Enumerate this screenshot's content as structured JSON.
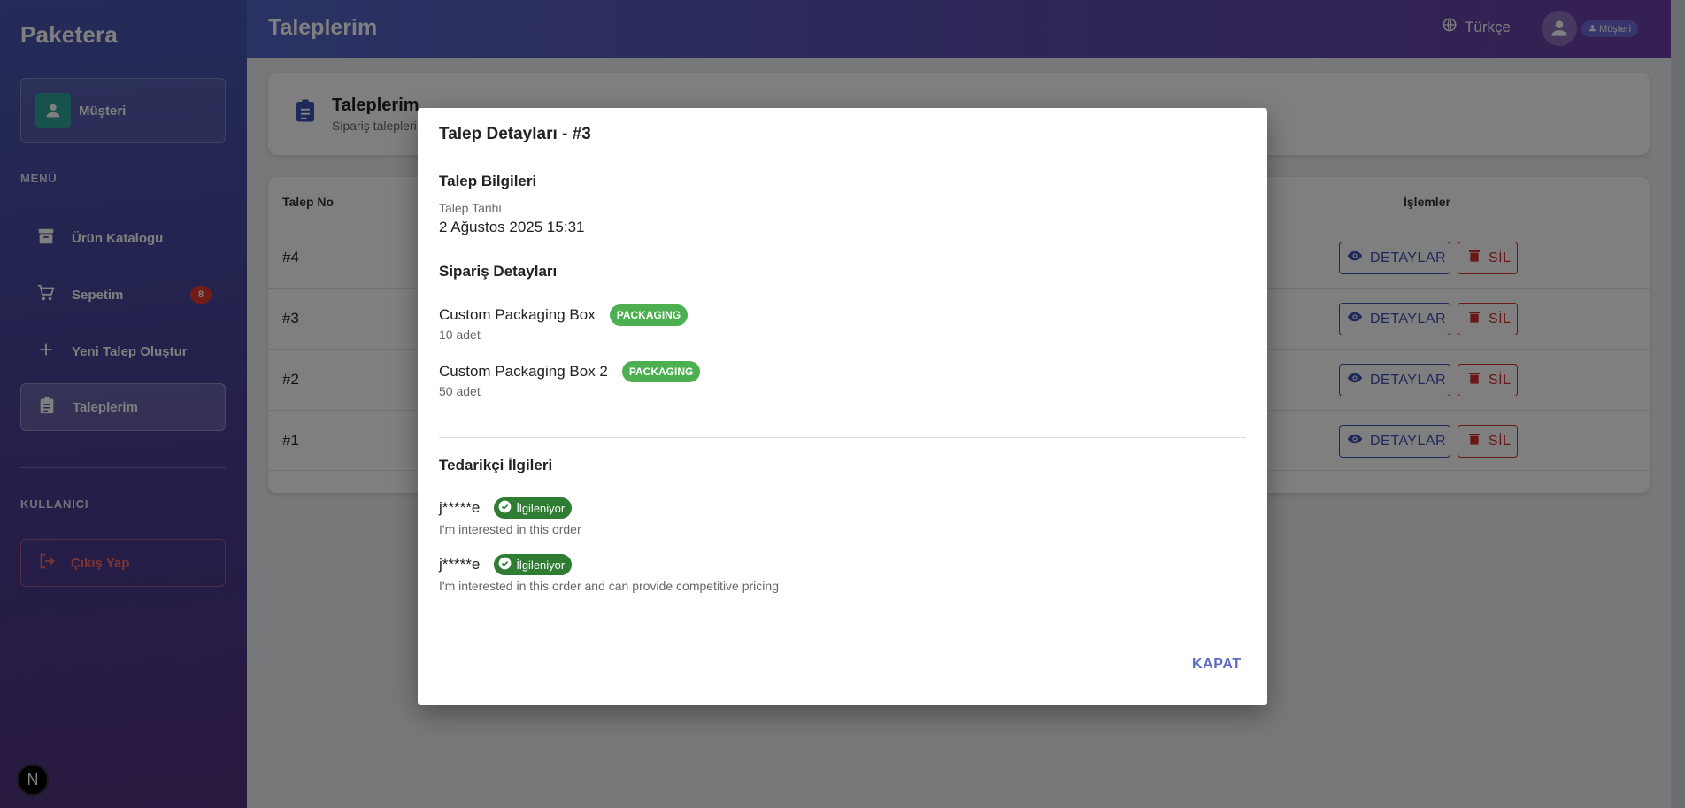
{
  "sidebar": {
    "brand": "Paketera",
    "user_role": "Müşteri",
    "menu_label": "MENÜ",
    "items": [
      {
        "label": "Ürün Katalogu"
      },
      {
        "label": "Sepetim",
        "badge": "8"
      },
      {
        "label": "Yeni Talep Oluştur"
      },
      {
        "label": "Taleplerim"
      }
    ],
    "user_label": "KULLANICI",
    "logout_label": "Çıkış Yap",
    "next_badge": "N"
  },
  "header": {
    "title": "Taleplerim",
    "language": "Türkçe",
    "role_chip": "Müşteri"
  },
  "page_card": {
    "title": "Taleplerim",
    "subtitle": "Sipariş talepleri"
  },
  "table": {
    "headers": {
      "id": "Talep No",
      "actions": "İşlemler"
    },
    "rows": [
      {
        "id": "#4"
      },
      {
        "id": "#3"
      },
      {
        "id": "#2"
      },
      {
        "id": "#1"
      }
    ],
    "detail_label": "DETAYLAR",
    "delete_label": "SİL"
  },
  "modal": {
    "title": "Talep Detayları - #3",
    "info_heading": "Talep Bilgileri",
    "date_label": "Talep Tarihi",
    "date_value": "2 Ağustos 2025 15:31",
    "order_heading": "Sipariş Detayları",
    "order_items": [
      {
        "name": "Custom Packaging Box",
        "category": "PACKAGING",
        "quantity": "10 adet"
      },
      {
        "name": "Custom Packaging Box 2",
        "category": "PACKAGING",
        "quantity": "50 adet"
      }
    ],
    "supplier_heading": "Tedarikçi İlgileri",
    "suppliers": [
      {
        "name": "j*****e",
        "status": "İlgileniyor",
        "message": "I'm interested in this order"
      },
      {
        "name": "j*****e",
        "status": "İlgileniyor",
        "message": "I'm interested in this order and can provide competitive pricing"
      }
    ],
    "close_label": "KAPAT"
  },
  "colors": {
    "primary": "#3f51b5",
    "danger": "#d32f2f",
    "success": "#4caf50",
    "success_dark": "#2e7d32"
  }
}
